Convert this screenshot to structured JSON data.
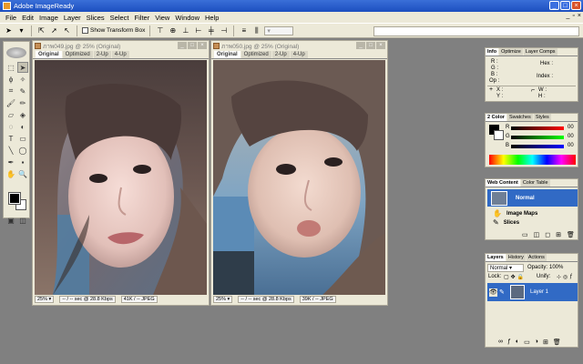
{
  "window": {
    "title": "Adobe ImageReady",
    "min": "_",
    "max": "□",
    "close": "×"
  },
  "menu": [
    "File",
    "Edit",
    "Image",
    "Layer",
    "Slices",
    "Select",
    "Filter",
    "View",
    "Window",
    "Help"
  ],
  "menu_controls": {
    "min": "_",
    "restore": "▫",
    "close": "×"
  },
  "options": {
    "show_transform_box": "Show Transform Box"
  },
  "documents": [
    {
      "title": "ภาพ049.jpg @ 25% (Original)",
      "tabs": [
        "Original",
        "Optimized",
        "2-Up",
        "4-Up"
      ],
      "active_tab": "Original",
      "zoom": "25%",
      "speed": "-- / -- sec @ 28.8 Kbps",
      "size": "41K / -- JPEG"
    },
    {
      "title": "ภาพ050.jpg @ 25% (Original)",
      "tabs": [
        "Original",
        "Optimized",
        "2-Up",
        "4-Up"
      ],
      "active_tab": "Original",
      "zoom": "25%",
      "speed": "-- / -- sec @ 28.8 Kbps",
      "size": "39K / -- JPEG"
    }
  ],
  "info_panel": {
    "tabs": [
      "Info",
      "Optimize",
      "Layer Comps"
    ],
    "labels": {
      "r": "R :",
      "g": "G :",
      "b": "B :",
      "op": "Op :",
      "hex": "Hex :",
      "index": "Index :",
      "x": "X :",
      "y": "Y :",
      "w": "W :",
      "h": "H :"
    }
  },
  "color_panel": {
    "tabs": [
      "2 Color",
      "Swatches",
      "Styles"
    ],
    "channels": [
      {
        "label": "R",
        "value": "00"
      },
      {
        "label": "G",
        "value": "00"
      },
      {
        "label": "B",
        "value": "00"
      }
    ]
  },
  "web_content_panel": {
    "tabs": [
      "Web Content",
      "Color Table"
    ],
    "items": [
      "Normal",
      "Image Maps",
      "Slices"
    ]
  },
  "layers_panel": {
    "tabs": [
      "Layers",
      "History",
      "Actions"
    ],
    "blend_mode": "Normal",
    "opacity_label": "Opacity:",
    "opacity_value": "100%",
    "lock_label": "Lock:",
    "unify_label": "Unify:",
    "layer_name": "Layer 1"
  },
  "colors": {
    "accent": "#316ac5",
    "panel_bg": "#ece9d8",
    "workspace": "#808080"
  }
}
